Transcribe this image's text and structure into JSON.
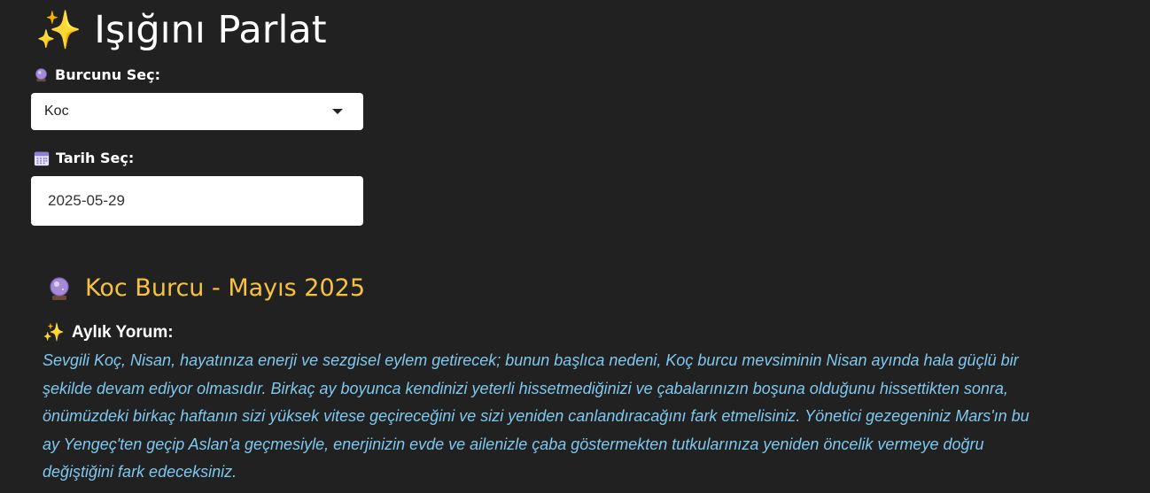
{
  "app": {
    "title": "Işığını Parlat",
    "title_icon": "sparkles-icon"
  },
  "zodiac_select": {
    "label": "Burcunu Seç:",
    "label_icon": "crystal-ball-icon",
    "value": "Koc"
  },
  "date_input": {
    "label": "Tarih Seç:",
    "label_icon": "calendar-icon",
    "value": "2025-05-29"
  },
  "result": {
    "title": "Koc Burcu - Mayıs 2025",
    "title_icon": "crystal-ball-icon",
    "title_color": "#f7c33c",
    "section_heading": "Aylık Yorum:",
    "section_icon": "sparkles-icon",
    "reading": "Sevgili Koç, Nisan, hayatınıza enerji ve sezgisel eylem getirecek; bunun başlıca nedeni, Koç burcu mevsiminin Nisan ayında hala güçlü bir şekilde devam ediyor olmasıdır. Birkaç ay boyunca kendinizi yeterli hissetmediğinizi ve çabalarınızın boşuna olduğunu hissettikten sonra, önümüzdeki birkaç haftanın sizi yüksek vitese geçireceğini ve sizi yeniden canlandıracağını fark etmelisiniz. Yönetici gezegeniniz Mars'ın bu ay Yengeç'ten geçip Aslan'a geçmesiyle, enerjinizin evde ve ailenizle çaba göstermekten tutkularınıza yeniden öncelik vermeye doğru değiştiğini fark edeceksiniz.",
    "reading_color": "#7fc8f0"
  },
  "colors": {
    "background": "#212121",
    "input_background": "#ffffff"
  }
}
